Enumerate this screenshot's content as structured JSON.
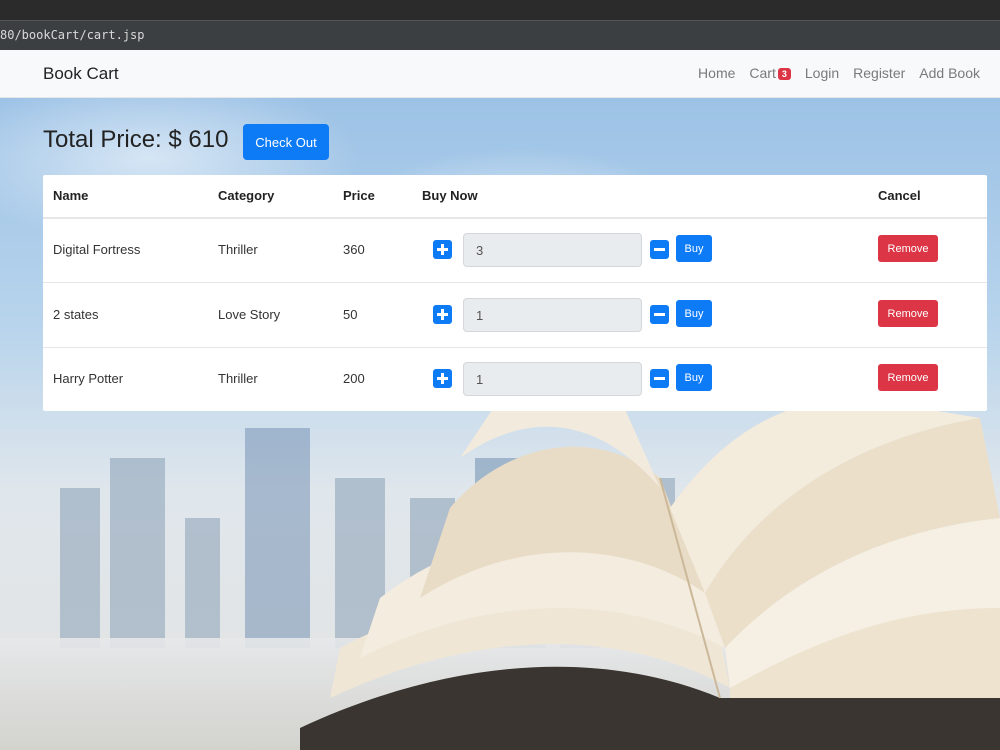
{
  "browser": {
    "url": "80/bookCart/cart.jsp"
  },
  "navbar": {
    "brand": "Book Cart",
    "links": {
      "home": "Home",
      "cart": "Cart",
      "cart_count": "3",
      "login": "Login",
      "register": "Register",
      "add_book": "Add Book"
    }
  },
  "cart": {
    "total_label": "Total Price: $ 610",
    "checkout_label": "Check Out",
    "columns": {
      "name": "Name",
      "category": "Category",
      "price": "Price",
      "buy_now": "Buy Now",
      "cancel": "Cancel"
    },
    "rows": [
      {
        "name": "Digital Fortress",
        "category": "Thriller",
        "price": "360",
        "quantity": "3",
        "buy_label": "Buy",
        "remove_label": "Remove"
      },
      {
        "name": "2 states",
        "category": "Love Story",
        "price": "50",
        "quantity": "1",
        "buy_label": "Buy",
        "remove_label": "Remove"
      },
      {
        "name": "Harry Potter",
        "category": "Thriller",
        "price": "200",
        "quantity": "1",
        "buy_label": "Buy",
        "remove_label": "Remove"
      }
    ]
  },
  "icons": {
    "increment": "plus-square-icon",
    "decrement": "minus-square-icon"
  },
  "colors": {
    "primary": "#0d7bf6",
    "danger": "#dc3545",
    "navbar": "#f8f9fa"
  }
}
